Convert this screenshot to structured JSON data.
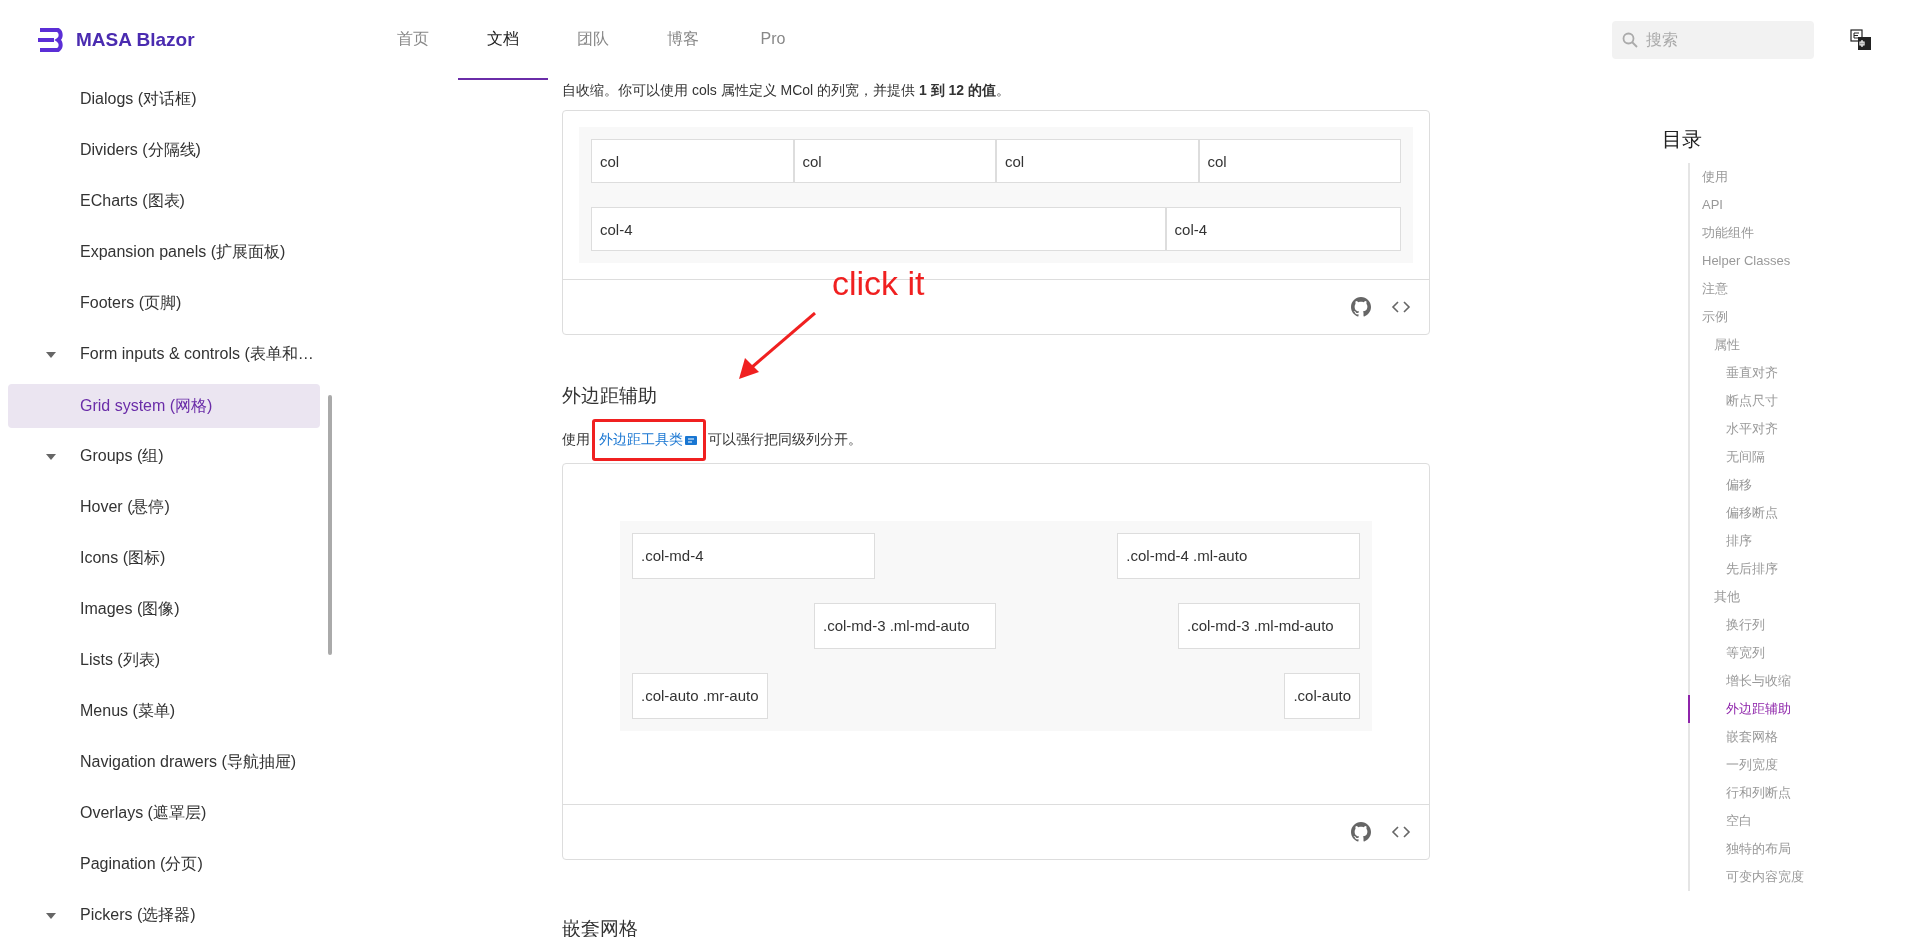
{
  "header": {
    "brand": "MASA Blazor",
    "nav": [
      {
        "label": "首页",
        "selected": false
      },
      {
        "label": "文档",
        "selected": true
      },
      {
        "label": "团队",
        "selected": false
      },
      {
        "label": "博客",
        "selected": false
      },
      {
        "label": "Pro",
        "selected": false
      }
    ],
    "search": {
      "placeholder": "搜索"
    }
  },
  "sidebar": {
    "items": [
      {
        "label": "Dialogs (对话框)",
        "expandable": false,
        "selected": false
      },
      {
        "label": "Dividers (分隔线)",
        "expandable": false,
        "selected": false
      },
      {
        "label": "ECharts (图表)",
        "expandable": false,
        "selected": false
      },
      {
        "label": "Expansion panels (扩展面板)",
        "expandable": false,
        "selected": false
      },
      {
        "label": "Footers (页脚)",
        "expandable": false,
        "selected": false
      },
      {
        "label": "Form inputs & controls (表单和…",
        "expandable": true,
        "selected": false
      },
      {
        "label": "Grid system (网格)",
        "expandable": false,
        "selected": true
      },
      {
        "label": "Groups (组)",
        "expandable": true,
        "selected": false
      },
      {
        "label": "Hover (悬停)",
        "expandable": false,
        "selected": false
      },
      {
        "label": "Icons (图标)",
        "expandable": false,
        "selected": false
      },
      {
        "label": "Images (图像)",
        "expandable": false,
        "selected": false
      },
      {
        "label": "Lists (列表)",
        "expandable": false,
        "selected": false
      },
      {
        "label": "Menus (菜单)",
        "expandable": false,
        "selected": false
      },
      {
        "label": "Navigation drawers (导航抽屉)",
        "expandable": false,
        "selected": false
      },
      {
        "label": "Overlays (遮罩层)",
        "expandable": false,
        "selected": false
      },
      {
        "label": "Pagination (分页)",
        "expandable": false,
        "selected": false
      },
      {
        "label": "Pickers (选择器)",
        "expandable": true,
        "selected": false
      }
    ]
  },
  "content": {
    "intro": "自收缩。你可以使用 cols 属性定义 MCol 的列宽，并提供 **1 到 12 的值**。",
    "demo_1": {
      "rows": [
        [
          "col",
          "col",
          "col",
          "col"
        ],
        [
          "col-4",
          "col-4"
        ]
      ]
    },
    "section": {
      "heading": "外边距辅助",
      "text_before": "使用",
      "link": "外边距工具类",
      "text_after": "可以强行把同级列分开。"
    },
    "demo_2": {
      "rows": [
        [
          ".col-md-4",
          ".col-md-4 .ml-auto"
        ],
        [
          ".col-md-3 .ml-md-auto",
          ".col-md-3 .ml-md-auto"
        ],
        [
          ".col-auto .mr-auto",
          ".col-auto"
        ]
      ]
    },
    "next_heading": "嵌套网格"
  },
  "annotation": {
    "text": "click it"
  },
  "toc": {
    "title": "目录",
    "items": [
      {
        "label": "使用",
        "selected": false
      },
      {
        "label": "API",
        "selected": false
      },
      {
        "label": "功能组件",
        "selected": false
      },
      {
        "label": "Helper Classes",
        "selected": false
      },
      {
        "label": "注意",
        "selected": false
      },
      {
        "label": "示例",
        "selected": false,
        "children": [
          {
            "label": "属性",
            "selected": false,
            "children": [
              {
                "label": "垂直对齐",
                "selected": false
              },
              {
                "label": "断点尺寸",
                "selected": false
              },
              {
                "label": "水平对齐",
                "selected": false
              },
              {
                "label": "无间隔",
                "selected": false
              },
              {
                "label": "偏移",
                "selected": false
              },
              {
                "label": "偏移断点",
                "selected": false
              },
              {
                "label": "排序",
                "selected": false
              },
              {
                "label": "先后排序",
                "selected": false
              }
            ]
          },
          {
            "label": "其他",
            "selected": false,
            "children": [
              {
                "label": "换行列",
                "selected": false
              },
              {
                "label": "等宽列",
                "selected": false
              },
              {
                "label": "增长与收缩",
                "selected": false
              },
              {
                "label": "外边距辅助",
                "selected": true
              },
              {
                "label": "嵌套网格",
                "selected": false
              },
              {
                "label": "一列宽度",
                "selected": false
              },
              {
                "label": "行和列断点",
                "selected": false
              },
              {
                "label": "空白",
                "selected": false
              },
              {
                "label": "独特的布局",
                "selected": false
              },
              {
                "label": "可变内容宽度",
                "selected": false
              }
            ]
          }
        ]
      }
    ]
  }
}
